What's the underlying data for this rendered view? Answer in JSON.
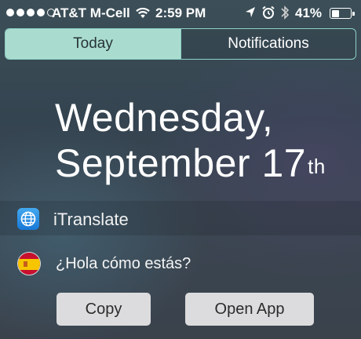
{
  "status_bar": {
    "carrier": "AT&T M-Cell",
    "time": "2:59 PM",
    "battery_pct": "41%",
    "battery_level": 0.41,
    "signal_bars_filled": 4,
    "signal_bars_total": 5
  },
  "tabs": [
    {
      "label": "Today",
      "active": true
    },
    {
      "label": "Notifications",
      "active": false
    }
  ],
  "date": {
    "line1": "Wednesday,",
    "line2": "September 17",
    "suffix": "th"
  },
  "widget": {
    "title": "iTranslate",
    "icon": "globe-icon",
    "phrase": "¿Hola cómo estás?",
    "flag": "spain-flag-icon",
    "buttons": {
      "copy": "Copy",
      "open_app": "Open App"
    }
  },
  "colors": {
    "tab_active_bg": "#a9dccf",
    "tab_border": "#8dd0c5",
    "button_bg": "#dcdcde"
  }
}
